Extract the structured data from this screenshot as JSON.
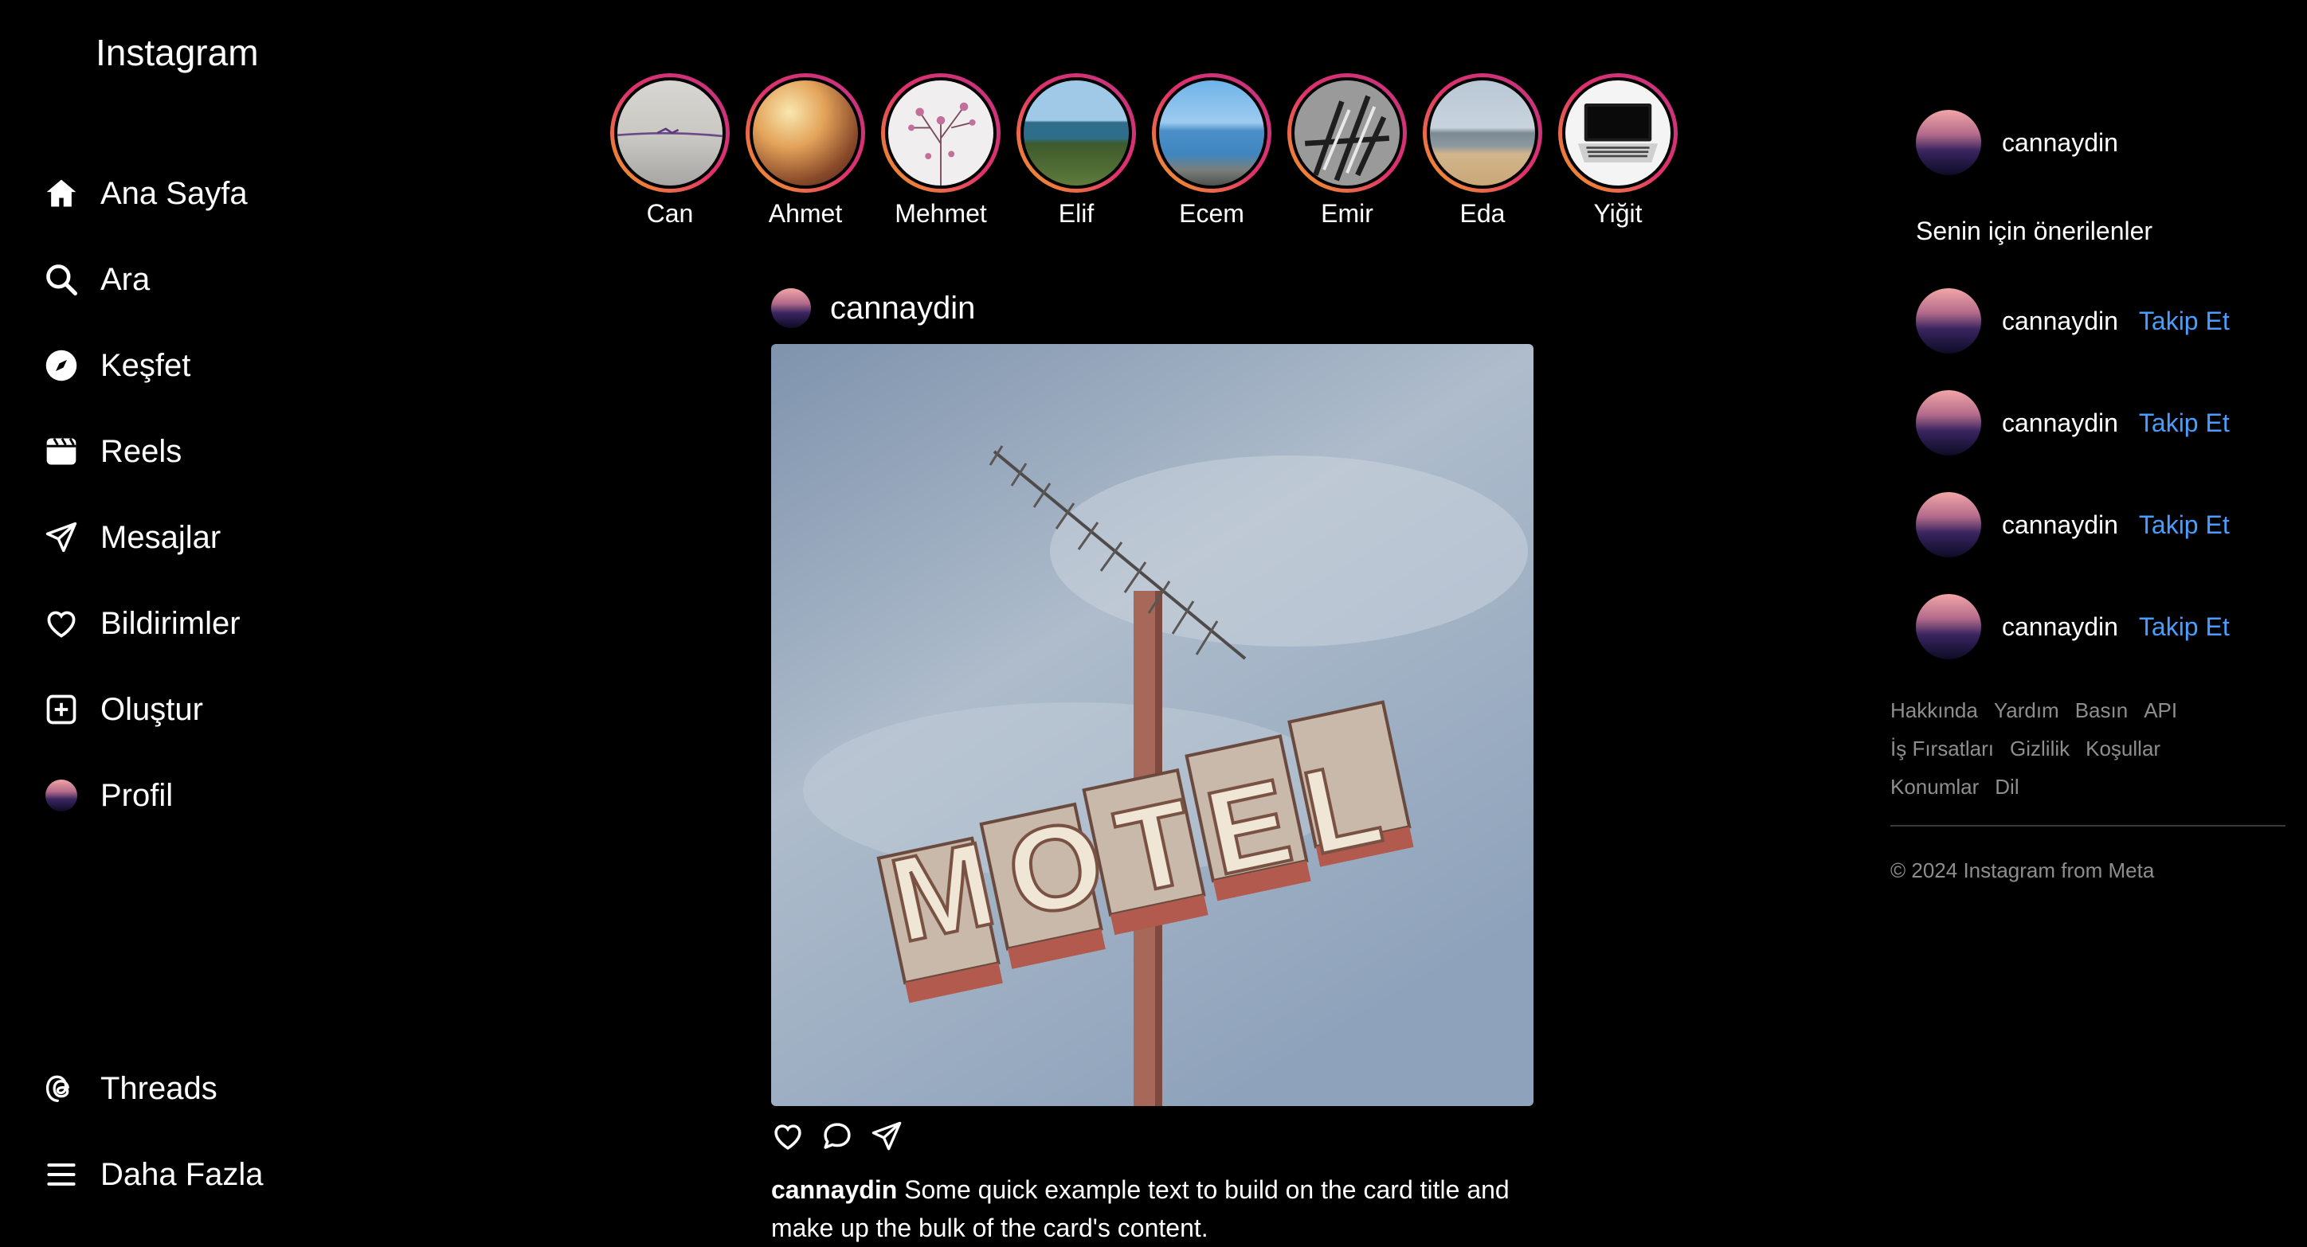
{
  "brand": {
    "logo_text": "Instagram"
  },
  "nav": {
    "items": [
      {
        "label": "Ana Sayfa",
        "icon": "home-icon"
      },
      {
        "label": "Ara",
        "icon": "search-icon"
      },
      {
        "label": "Keşfet",
        "icon": "compass-icon"
      },
      {
        "label": "Reels",
        "icon": "reels-icon"
      },
      {
        "label": "Mesajlar",
        "icon": "send-icon"
      },
      {
        "label": "Bildirimler",
        "icon": "heart-icon"
      },
      {
        "label": "Oluştur",
        "icon": "plus-square-icon"
      },
      {
        "label": "Profil",
        "icon": "avatar"
      }
    ],
    "bottom": [
      {
        "label": "Threads",
        "icon": "threads-icon"
      },
      {
        "label": "Daha Fazla",
        "icon": "menu-icon"
      }
    ]
  },
  "stories": [
    {
      "name": "Can"
    },
    {
      "name": "Ahmet"
    },
    {
      "name": "Mehmet"
    },
    {
      "name": "Elif"
    },
    {
      "name": "Ecem"
    },
    {
      "name": "Emir"
    },
    {
      "name": "Eda"
    },
    {
      "name": "Yiğit"
    }
  ],
  "post": {
    "username": "cannaydin",
    "image_text": "MOTEL",
    "caption_user": "cannaydin",
    "caption_text": " Some quick example text to build on the card title and make up the bulk of the card's content."
  },
  "sidebar_right": {
    "current_user": "cannaydin",
    "suggestions_title": "Senin için önerilenler",
    "suggestions": [
      {
        "username": "cannaydin",
        "action": "Takip Et"
      },
      {
        "username": "cannaydin",
        "action": "Takip Et"
      },
      {
        "username": "cannaydin",
        "action": "Takip Et"
      },
      {
        "username": "cannaydin",
        "action": "Takip Et"
      }
    ],
    "footer_rows": [
      [
        "Hakkında",
        "Yardım",
        "Basın",
        "API"
      ],
      [
        "İş Fırsatları",
        "Gizlilik",
        "Koşullar"
      ],
      [
        "Konumlar",
        "Dil"
      ]
    ],
    "copyright": "© 2024 Instagram from Meta"
  },
  "colors": {
    "link": "#4a9dff",
    "background": "#000000",
    "muted": "#8e8e8e"
  }
}
